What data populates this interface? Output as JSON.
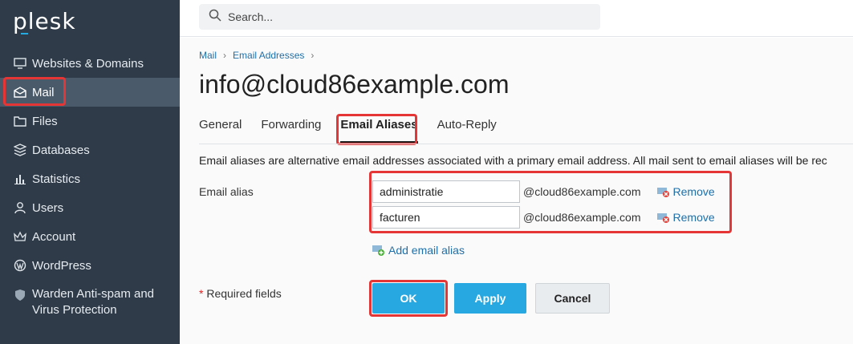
{
  "app": {
    "logo": "plesk"
  },
  "sidebar": {
    "items": [
      {
        "label": "Websites & Domains",
        "icon": "monitor-icon"
      },
      {
        "label": "Mail",
        "icon": "mail-icon"
      },
      {
        "label": "Files",
        "icon": "folder-icon"
      },
      {
        "label": "Databases",
        "icon": "database-icon"
      },
      {
        "label": "Statistics",
        "icon": "bar-chart-icon"
      },
      {
        "label": "Users",
        "icon": "user-icon"
      },
      {
        "label": "Account",
        "icon": "crown-icon"
      },
      {
        "label": "WordPress",
        "icon": "wordpress-icon"
      },
      {
        "label_line1": "Warden Anti-spam and",
        "label_line2": "Virus Protection",
        "icon": "shield-icon"
      }
    ],
    "active": "Mail"
  },
  "search": {
    "placeholder": "Search..."
  },
  "breadcrumb": {
    "items": [
      "Mail",
      "Email Addresses"
    ]
  },
  "page_title": "info@cloud86example.com",
  "tabs": [
    "General",
    "Forwarding",
    "Email Aliases",
    "Auto-Reply"
  ],
  "active_tab": "Email Aliases",
  "description": "Email aliases are alternative email addresses associated with a primary email address. All mail sent to email aliases will be rec",
  "form": {
    "alias_label": "Email alias",
    "aliases": [
      {
        "value": "administratie",
        "domain": "@cloud86example.com",
        "remove_label": "Remove"
      },
      {
        "value": "facturen",
        "domain": "@cloud86example.com",
        "remove_label": "Remove"
      }
    ],
    "add_label": "Add email alias",
    "required_star": "*",
    "required_text": " Required fields"
  },
  "buttons": {
    "ok": "OK",
    "apply": "Apply",
    "cancel": "Cancel"
  },
  "colors": {
    "sidebar_bg": "#2f3b48",
    "accent": "#28a8e0",
    "highlight": "#e53535",
    "link": "#1f6fa8"
  }
}
